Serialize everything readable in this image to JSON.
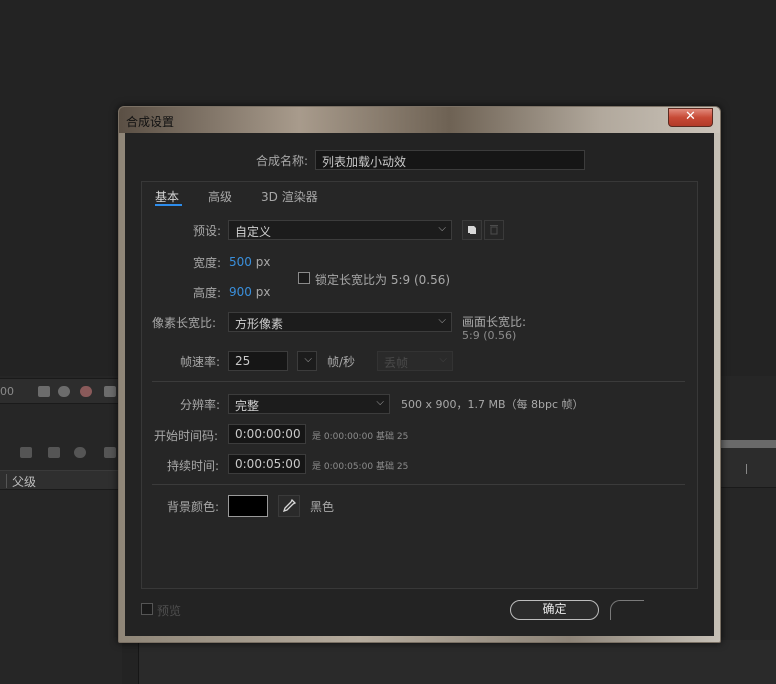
{
  "background": {
    "timecode_fragment": "00",
    "layer_column_header": "父级"
  },
  "dialog": {
    "title": "合成设置",
    "close_glyph": "✕",
    "comp_name_label": "合成名称:",
    "comp_name_value": "列表加载小动效",
    "tabs": [
      {
        "label": "基本",
        "active": true
      },
      {
        "label": "高级",
        "active": false
      },
      {
        "label": "3D 渲染器",
        "active": false
      }
    ],
    "preset_label": "预设:",
    "preset_value": "自定义",
    "width_label": "宽度:",
    "width_value": "500",
    "width_unit": "px",
    "height_label": "高度:",
    "height_value": "900",
    "height_unit": "px",
    "lock_aspect_label": "锁定长宽比为 5:9 (0.56)",
    "lock_aspect_checked": false,
    "pixel_aspect_label": "像素长宽比:",
    "pixel_aspect_value": "方形像素",
    "frame_aspect_label": "画面长宽比:",
    "frame_aspect_value": "5:9 (0.56)",
    "frame_rate_label": "帧速率:",
    "frame_rate_value": "25",
    "frame_rate_unit": "帧/秒",
    "drop_frame_value": "丢帧",
    "resolution_label": "分辨率:",
    "resolution_value": "完整",
    "resolution_info": "500 x 900，1.7 MB（每 8bpc 帧）",
    "start_tc_label": "开始时间码:",
    "start_tc_value": "0:00:00:00",
    "start_tc_is": "是 0:00:00:00",
    "start_tc_base": "基础 25",
    "duration_label": "持续时间:",
    "duration_value": "0:00:05:00",
    "duration_is": "是 0:00:05:00",
    "duration_base": "基础 25",
    "bg_color_label": "背景颜色:",
    "bg_color_hex": "#000000",
    "bg_color_name": "黑色",
    "preview_label": "预览",
    "ok_label": "确定",
    "accent_color": "#2d8ceb",
    "value_color": "#3a8fdb"
  }
}
